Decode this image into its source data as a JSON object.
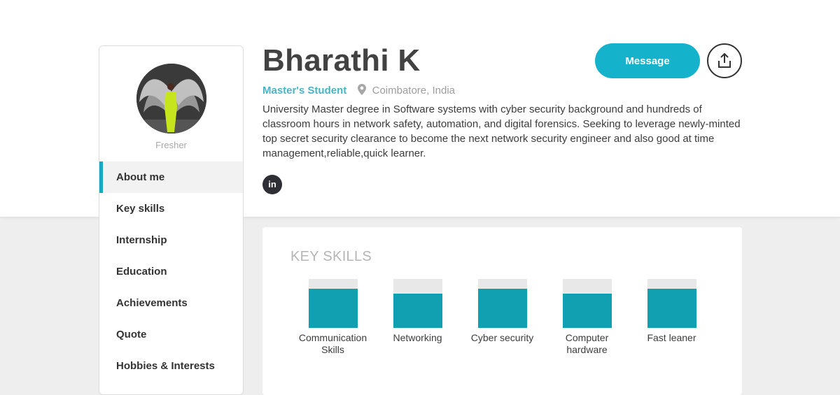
{
  "profile": {
    "name": "Bharathi K",
    "role": "Master's Student",
    "location": "Coimbatore, India",
    "status": "Fresher",
    "summary": "University Master degree in Software systems with cyber security background and hundreds of classroom hours in network safety, automation, and digital forensics. Seeking to leverage newly-minted top secret security clearance to become the next network security engineer and also good at time management,reliable,quick learner.",
    "social": {
      "linkedin_label": "in"
    }
  },
  "actions": {
    "message_label": "Message"
  },
  "nav": {
    "items": [
      {
        "label": "About me",
        "active": true
      },
      {
        "label": "Key skills"
      },
      {
        "label": "Internship"
      },
      {
        "label": "Education"
      },
      {
        "label": "Achievements"
      },
      {
        "label": "Quote"
      },
      {
        "label": "Hobbies & Interests"
      }
    ]
  },
  "skills": {
    "title": "KEY SKILLS",
    "items": [
      {
        "label": "Communication Skills",
        "level": 0.8
      },
      {
        "label": "Networking",
        "level": 0.7
      },
      {
        "label": "Cyber security",
        "level": 0.8
      },
      {
        "label": "Computer hardware",
        "level": 0.7
      },
      {
        "label": "Fast leaner",
        "level": 0.8
      }
    ]
  },
  "colors": {
    "accent": "#15b2cc",
    "skill_fill": "#119fb2",
    "role_text": "#4ab3c4"
  },
  "icons": [
    "location-pin-icon",
    "share-icon",
    "linkedin-icon"
  ]
}
